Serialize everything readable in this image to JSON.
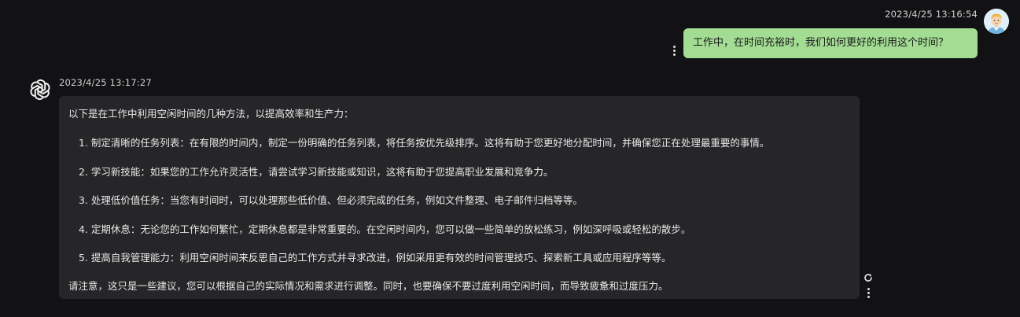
{
  "user_message": {
    "timestamp": "2023/4/25 13:16:54",
    "text": "工作中，在时间充裕时，我们如何更好的利用这个时间？",
    "avatar_icon": "user-avatar-icon",
    "bubble_color": "#a3dc93"
  },
  "assistant_message": {
    "timestamp": "2023/4/25 13:17:27",
    "avatar_icon": "openai-logo-icon",
    "intro": "以下是在工作中利用空闲时间的几种方法，以提高效率和生产力：",
    "items": [
      "1. 制定清晰的任务列表：在有限的时间内，制定一份明确的任务列表，将任务按优先级排序。这将有助于您更好地分配时间，并确保您正在处理最重要的事情。",
      "2. 学习新技能：如果您的工作允许灵活性，请尝试学习新技能或知识，这将有助于您提高职业发展和竞争力。",
      "3. 处理低价值任务：当您有时间时，可以处理那些低价值、但必须完成的任务，例如文件整理、电子邮件归档等等。",
      "4. 定期休息：无论您的工作如何繁忙，定期休息都是非常重要的。在空闲时间内，您可以做一些简单的放松练习，例如深呼吸或轻松的散步。",
      "5. 提高自我管理能力：利用空闲时间来反思自己的工作方式并寻求改进，例如采用更有效的时间管理技巧、探索新工具或应用程序等等。"
    ],
    "closing": "请注意，这只是一些建议，您可以根据自己的实际情况和需求进行调整。同时，也要确保不要过度利用空闲时间，而导致疲惫和过度压力。",
    "bubble_color": "#262628"
  },
  "icons": {
    "more": "more-vertical-icon",
    "refresh": "refresh-icon"
  }
}
